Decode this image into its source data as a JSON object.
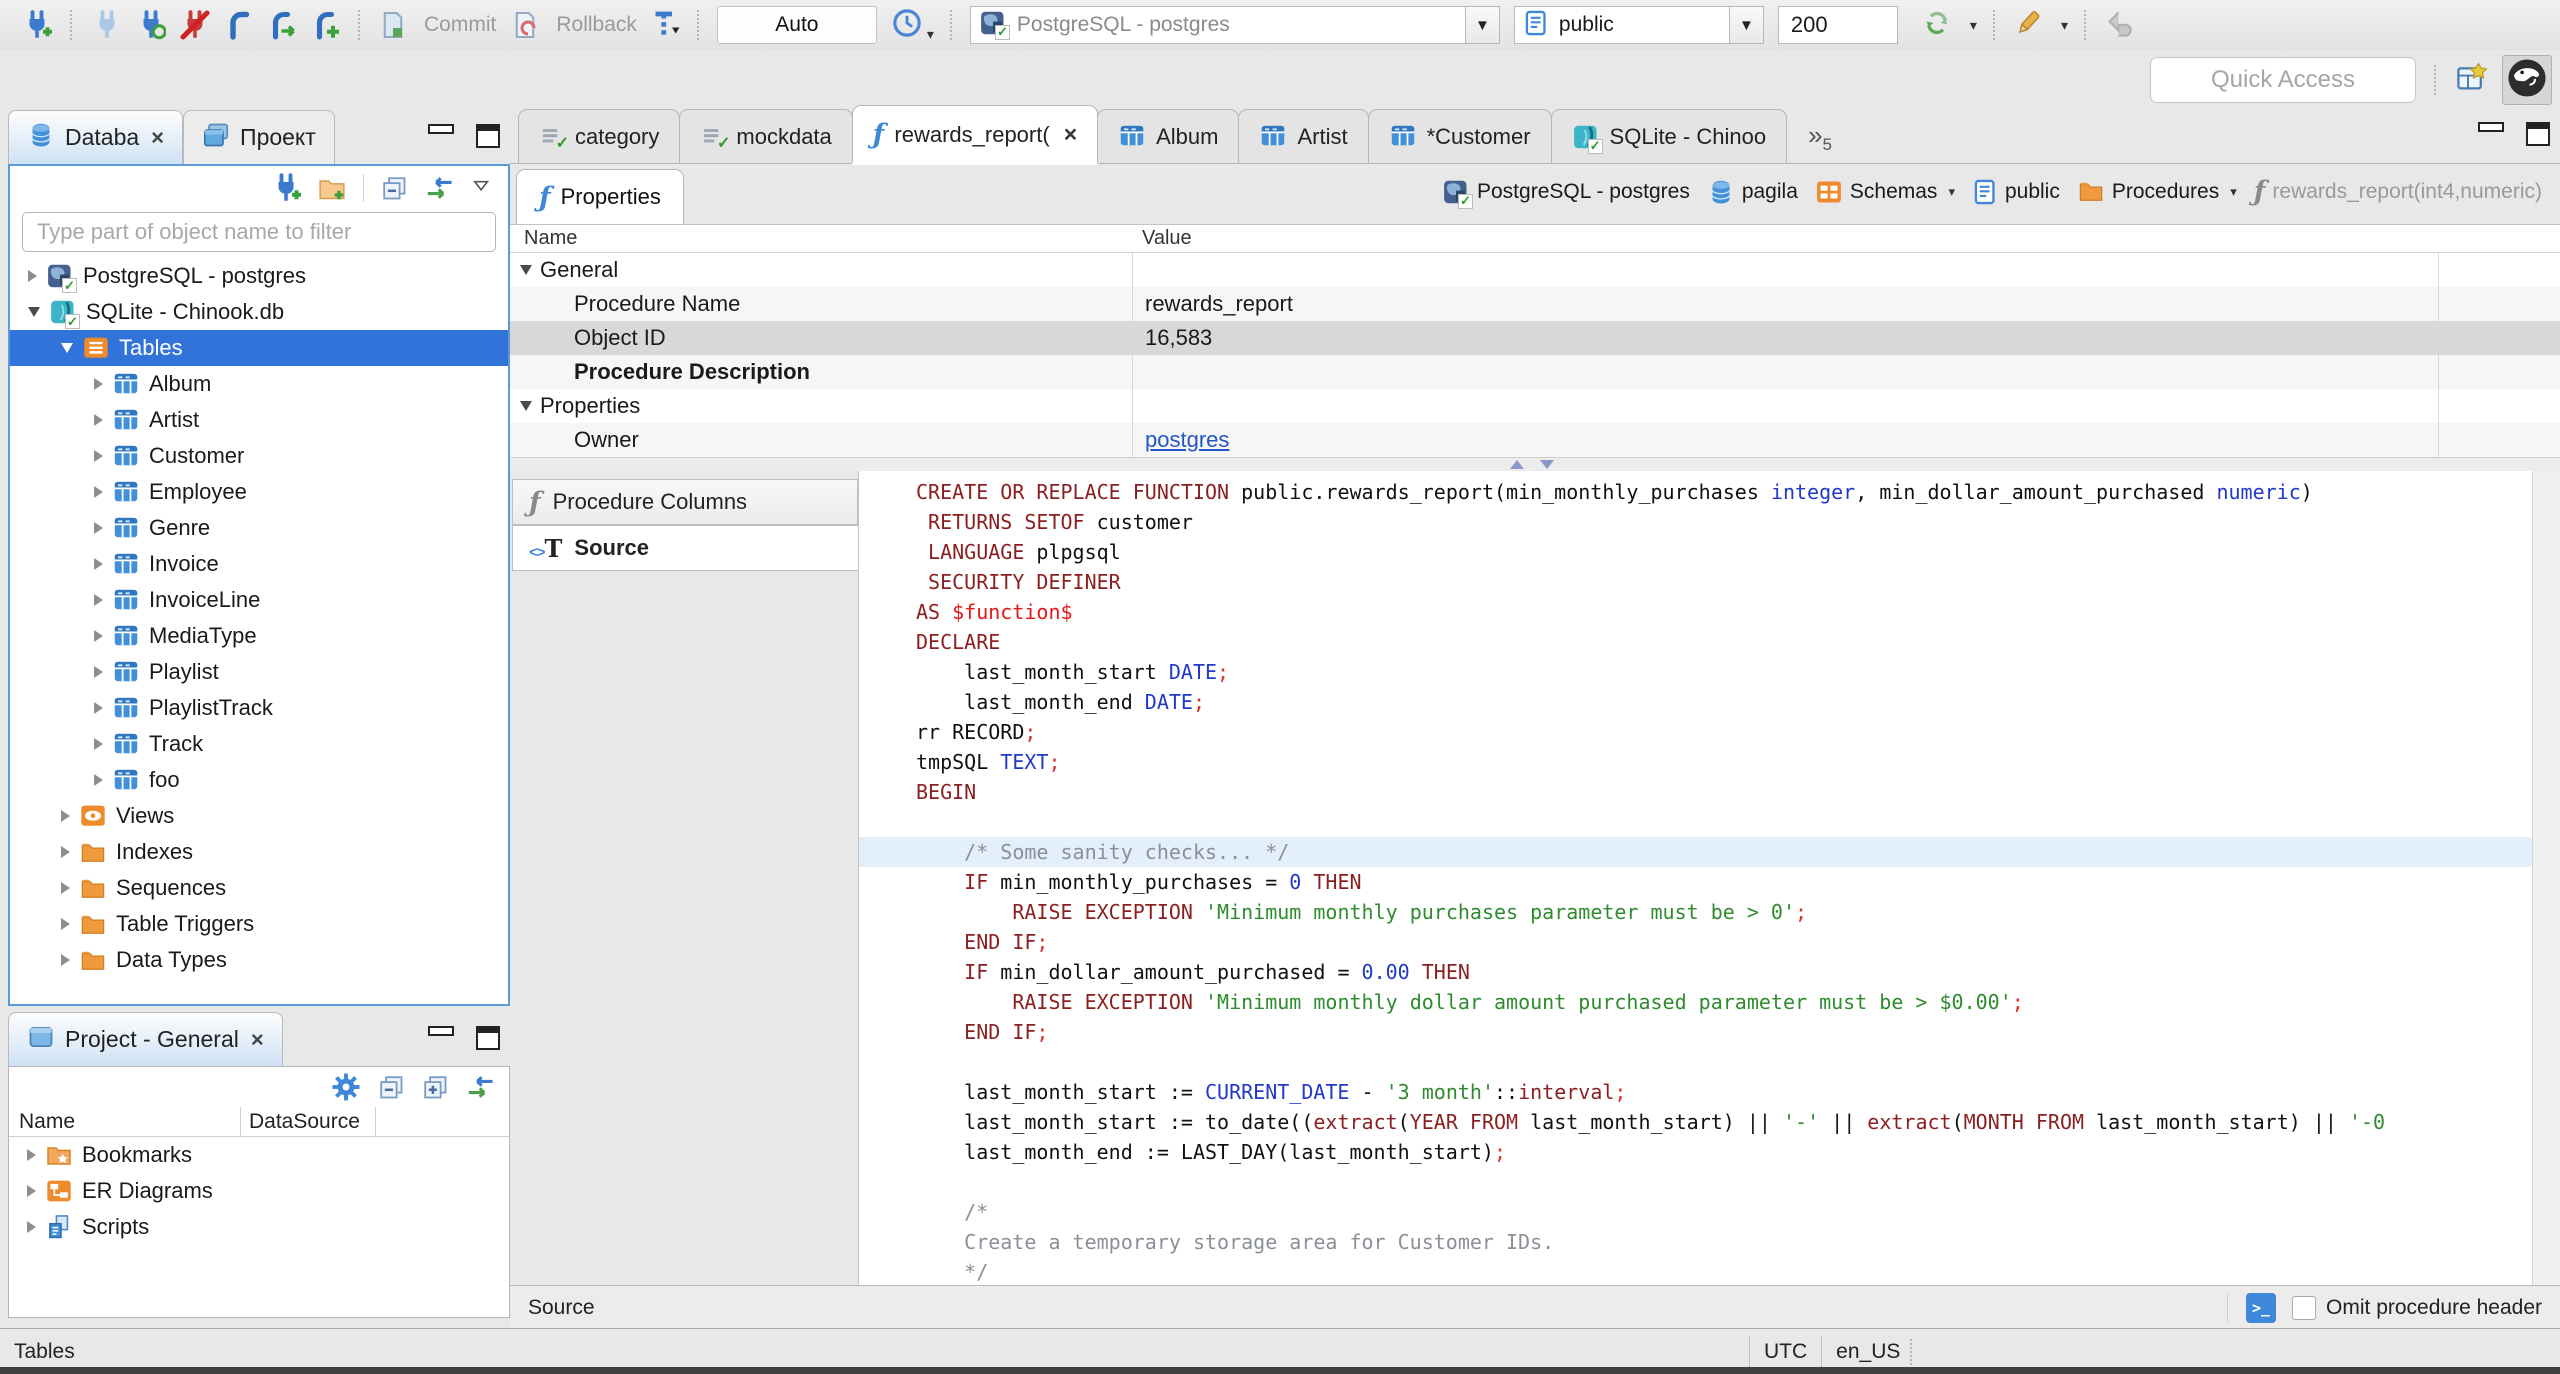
{
  "toolbar": {
    "auto_label": "Auto",
    "commit_label": "Commit",
    "rollback_label": "Rollback",
    "connection_combo": "PostgreSQL - postgres",
    "schema_combo": "public",
    "fetch_size": "200",
    "quick_access_placeholder": "Quick Access"
  },
  "glyphs": {
    "function": "ƒ",
    "check": "✓",
    "close": "×",
    "chevron": "▾",
    "dropdown": "▼",
    "overflow": "»",
    "terminal": ">_",
    "source_angles": "<>",
    "source_t": "T"
  },
  "editor_tabs": [
    {
      "label": "category",
      "icon": "sql-script"
    },
    {
      "label": "mockdata",
      "icon": "sql-script"
    },
    {
      "label": "rewards_report(",
      "icon": "function",
      "active": true,
      "close": true
    },
    {
      "label": "Album",
      "icon": "table"
    },
    {
      "label": "Artist",
      "icon": "table"
    },
    {
      "label": "*Customer",
      "icon": "table"
    },
    {
      "label": "SQLite - Chinoo",
      "icon": "sqlite"
    }
  ],
  "tab_overflow_count": "5",
  "subtab_label": "Properties",
  "breadcrumb": [
    {
      "label": "PostgreSQL - postgres",
      "icon": "postgres"
    },
    {
      "label": "pagila",
      "icon": "database"
    },
    {
      "label": "Schemas",
      "icon": "schemas",
      "dropdown": true
    },
    {
      "label": "public",
      "icon": "schema-doc"
    },
    {
      "label": "Procedures",
      "icon": "folder",
      "dropdown": true
    },
    {
      "label": "rewards_report(int4,numeric)",
      "icon": "function",
      "muted": true
    }
  ],
  "properties_grid": {
    "columns": [
      "Name",
      "Value"
    ],
    "rows": [
      {
        "name": "General",
        "value": "",
        "group": true
      },
      {
        "name": "Procedure Name",
        "value": "rewards_report",
        "stripe": true
      },
      {
        "name": "Object ID",
        "value": "16,583",
        "selected": true
      },
      {
        "name": "Procedure Description",
        "value": "",
        "bold": true,
        "stripe": true
      },
      {
        "name": "Properties",
        "value": "",
        "group": true
      },
      {
        "name": "Owner",
        "value": "postgres",
        "link": true,
        "stripe": true
      }
    ]
  },
  "side_tabs": [
    {
      "label": "Procedure Columns",
      "icon": "function-gray"
    },
    {
      "label": "Source",
      "icon": "source",
      "active": true
    }
  ],
  "navigator": {
    "tabs": [
      {
        "label": "Databa",
        "icon": "database",
        "active": true,
        "close": true
      },
      {
        "label": "Проект",
        "icon": "projects"
      }
    ],
    "filter_placeholder": "Type part of object name to filter",
    "tree": [
      {
        "label": "PostgreSQL - postgres",
        "icon": "postgres",
        "level": 0,
        "exp": "col"
      },
      {
        "label": "SQLite - Chinook.db",
        "icon": "sqlite",
        "level": 0,
        "exp": "open"
      },
      {
        "label": "Tables",
        "icon": "tables",
        "level": 1,
        "exp": "open",
        "selected": true
      },
      {
        "label": "Album",
        "icon": "table",
        "level": 2,
        "exp": "col"
      },
      {
        "label": "Artist",
        "icon": "table",
        "level": 2,
        "exp": "col"
      },
      {
        "label": "Customer",
        "icon": "table",
        "level": 2,
        "exp": "col"
      },
      {
        "label": "Employee",
        "icon": "table",
        "level": 2,
        "exp": "col"
      },
      {
        "label": "Genre",
        "icon": "table",
        "level": 2,
        "exp": "col"
      },
      {
        "label": "Invoice",
        "icon": "table",
        "level": 2,
        "exp": "col"
      },
      {
        "label": "InvoiceLine",
        "icon": "table",
        "level": 2,
        "exp": "col"
      },
      {
        "label": "MediaType",
        "icon": "table",
        "level": 2,
        "exp": "col"
      },
      {
        "label": "Playlist",
        "icon": "table",
        "level": 2,
        "exp": "col"
      },
      {
        "label": "PlaylistTrack",
        "icon": "table",
        "level": 2,
        "exp": "col"
      },
      {
        "label": "Track",
        "icon": "table",
        "level": 2,
        "exp": "col"
      },
      {
        "label": "foo",
        "icon": "table",
        "level": 2,
        "exp": "col"
      },
      {
        "label": "Views",
        "icon": "views",
        "level": 1,
        "exp": "col"
      },
      {
        "label": "Indexes",
        "icon": "folder",
        "level": 1,
        "exp": "col"
      },
      {
        "label": "Sequences",
        "icon": "folder",
        "level": 1,
        "exp": "col"
      },
      {
        "label": "Table Triggers",
        "icon": "folder",
        "level": 1,
        "exp": "col"
      },
      {
        "label": "Data Types",
        "icon": "folder",
        "level": 1,
        "exp": "col"
      }
    ]
  },
  "project_panel": {
    "tab_label": "Project - General",
    "columns": [
      "Name",
      "DataSource"
    ],
    "tree": [
      {
        "label": "Bookmarks",
        "icon": "bookmarks",
        "level": 0,
        "exp": "col"
      },
      {
        "label": "ER Diagrams",
        "icon": "erd",
        "level": 0,
        "exp": "col"
      },
      {
        "label": "Scripts",
        "icon": "scripts",
        "level": 0,
        "exp": "col"
      }
    ]
  },
  "source_editor": {
    "status_label": "Source",
    "omit_label": "Omit procedure header",
    "lines": [
      {
        "segs": [
          {
            "t": "CREATE OR REPLACE FUNCTION",
            "c": "kw"
          },
          {
            "t": " public.rewards_report(min_monthly_purchases ",
            "c": "pl"
          },
          {
            "t": "integer",
            "c": "ty"
          },
          {
            "t": ", min_dollar_amount_purchased ",
            "c": "pl"
          },
          {
            "t": "numeric",
            "c": "ty"
          },
          {
            "t": ")",
            "c": "pl"
          }
        ]
      },
      {
        "segs": [
          {
            "t": " ",
            "c": "pl"
          },
          {
            "t": "RETURNS SETOF",
            "c": "kw"
          },
          {
            "t": " customer",
            "c": "pl"
          }
        ]
      },
      {
        "segs": [
          {
            "t": " ",
            "c": "pl"
          },
          {
            "t": "LANGUAGE",
            "c": "kw"
          },
          {
            "t": " plpgsql",
            "c": "pl"
          }
        ]
      },
      {
        "segs": [
          {
            "t": " ",
            "c": "pl"
          },
          {
            "t": "SECURITY DEFINER",
            "c": "kw"
          }
        ]
      },
      {
        "segs": [
          {
            "t": "AS",
            "c": "kw"
          },
          {
            "t": " ",
            "c": "pl"
          },
          {
            "t": "$function$",
            "c": "rd"
          }
        ]
      },
      {
        "segs": [
          {
            "t": "DECLARE",
            "c": "kw"
          }
        ]
      },
      {
        "segs": [
          {
            "t": "    last_month_start ",
            "c": "pl"
          },
          {
            "t": "DATE",
            "c": "ty"
          },
          {
            "t": ";",
            "c": "pu"
          }
        ]
      },
      {
        "segs": [
          {
            "t": "    last_month_end ",
            "c": "pl"
          },
          {
            "t": "DATE",
            "c": "ty"
          },
          {
            "t": ";",
            "c": "pu"
          }
        ]
      },
      {
        "segs": [
          {
            "t": "rr RECORD",
            "c": "pl"
          },
          {
            "t": ";",
            "c": "pu"
          }
        ]
      },
      {
        "segs": [
          {
            "t": "tmpSQL ",
            "c": "pl"
          },
          {
            "t": "TEXT",
            "c": "ty"
          },
          {
            "t": ";",
            "c": "pu"
          }
        ]
      },
      {
        "segs": [
          {
            "t": "BEGIN",
            "c": "kw"
          }
        ]
      },
      {
        "segs": []
      },
      {
        "hl": true,
        "segs": [
          {
            "t": "    /* Some sanity checks... */",
            "c": "cm"
          }
        ]
      },
      {
        "segs": [
          {
            "t": "    ",
            "c": "pl"
          },
          {
            "t": "IF",
            "c": "kw"
          },
          {
            "t": " min_monthly_purchases = ",
            "c": "pl"
          },
          {
            "t": "0",
            "c": "ty"
          },
          {
            "t": " ",
            "c": "pl"
          },
          {
            "t": "THEN",
            "c": "kw"
          }
        ]
      },
      {
        "segs": [
          {
            "t": "        ",
            "c": "pl"
          },
          {
            "t": "RAISE EXCEPTION",
            "c": "kw"
          },
          {
            "t": " ",
            "c": "pl"
          },
          {
            "t": "'Minimum monthly purchases parameter must be > 0'",
            "c": "st"
          },
          {
            "t": ";",
            "c": "pu"
          }
        ]
      },
      {
        "segs": [
          {
            "t": "    ",
            "c": "pl"
          },
          {
            "t": "END IF",
            "c": "kw"
          },
          {
            "t": ";",
            "c": "pu"
          }
        ]
      },
      {
        "segs": [
          {
            "t": "    ",
            "c": "pl"
          },
          {
            "t": "IF",
            "c": "kw"
          },
          {
            "t": " min_dollar_amount_purchased = ",
            "c": "pl"
          },
          {
            "t": "0.00",
            "c": "ty"
          },
          {
            "t": " ",
            "c": "pl"
          },
          {
            "t": "THEN",
            "c": "kw"
          }
        ]
      },
      {
        "segs": [
          {
            "t": "        ",
            "c": "pl"
          },
          {
            "t": "RAISE EXCEPTION",
            "c": "kw"
          },
          {
            "t": " ",
            "c": "pl"
          },
          {
            "t": "'Minimum monthly dollar amount purchased parameter must be > $0.00'",
            "c": "st"
          },
          {
            "t": ";",
            "c": "pu"
          }
        ]
      },
      {
        "segs": [
          {
            "t": "    ",
            "c": "pl"
          },
          {
            "t": "END IF",
            "c": "kw"
          },
          {
            "t": ";",
            "c": "pu"
          }
        ]
      },
      {
        "segs": []
      },
      {
        "segs": [
          {
            "t": "    last_month_start := ",
            "c": "pl"
          },
          {
            "t": "CURRENT_DATE",
            "c": "ty"
          },
          {
            "t": " - ",
            "c": "pl"
          },
          {
            "t": "'3 month'",
            "c": "st"
          },
          {
            "t": "::",
            "c": "pl"
          },
          {
            "t": "interval",
            "c": "kw"
          },
          {
            "t": ";",
            "c": "pu"
          }
        ]
      },
      {
        "segs": [
          {
            "t": "    last_month_start := to_date((",
            "c": "pl"
          },
          {
            "t": "extract",
            "c": "kw"
          },
          {
            "t": "(",
            "c": "pl"
          },
          {
            "t": "YEAR FROM",
            "c": "kw"
          },
          {
            "t": " last_month_start) || ",
            "c": "pl"
          },
          {
            "t": "'-'",
            "c": "st"
          },
          {
            "t": " || ",
            "c": "pl"
          },
          {
            "t": "extract",
            "c": "kw"
          },
          {
            "t": "(",
            "c": "pl"
          },
          {
            "t": "MONTH FROM",
            "c": "kw"
          },
          {
            "t": " last_month_start) || ",
            "c": "pl"
          },
          {
            "t": "'-0",
            "c": "st"
          }
        ]
      },
      {
        "segs": [
          {
            "t": "    last_month_end := LAST_DAY(last_month_start)",
            "c": "pl"
          },
          {
            "t": ";",
            "c": "pu"
          }
        ]
      },
      {
        "segs": []
      },
      {
        "segs": [
          {
            "t": "    /*",
            "c": "cm"
          }
        ]
      },
      {
        "segs": [
          {
            "t": "    Create a temporary storage area for Customer IDs.",
            "c": "cm"
          }
        ]
      },
      {
        "segs": [
          {
            "t": "    */",
            "c": "cm"
          }
        ]
      }
    ]
  },
  "status_bar": {
    "left": "Tables",
    "timezone": "UTC",
    "locale": "en_US"
  }
}
